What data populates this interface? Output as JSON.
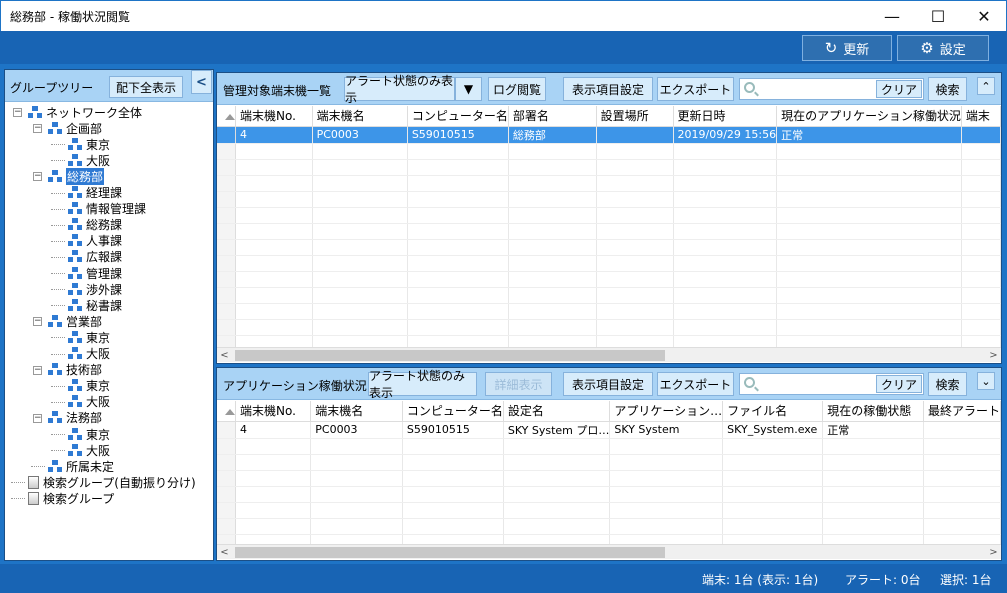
{
  "window": {
    "title": "総務部 - 稼働状況閲覧",
    "minimize": "—",
    "maximize": "☐",
    "close": "✕"
  },
  "toolbar": {
    "refresh_label": "更新",
    "settings_label": "設定"
  },
  "tree_panel": {
    "title": "グループツリー",
    "show_all_label": "配下全表示",
    "collapse": "<",
    "items": [
      "ネットワーク全体",
      "企画部",
      "東京",
      "大阪",
      "総務部",
      "経理課",
      "情報管理課",
      "総務課",
      "人事課",
      "広報課",
      "管理課",
      "渉外課",
      "秘書課",
      "営業部",
      "東京",
      "大阪",
      "技術部",
      "東京",
      "大阪",
      "法務部",
      "東京",
      "大阪",
      "所属未定",
      "検索グループ(自動振り分け)",
      "検索グループ"
    ]
  },
  "devices_panel": {
    "title": "管理対象端末機一覧",
    "alert_only_label": "アラート状態のみ表示",
    "log_view_label": "ログ閲覧",
    "display_settings_label": "表示項目設定",
    "export_label": "エクスポート",
    "clear_label": "クリア",
    "search_label": "検索",
    "search_placeholder": "",
    "collapse": "⌃",
    "columns": [
      "端末機No.",
      "端末機名",
      "コンピューター名",
      "部署名",
      "設置場所",
      "更新日時",
      "現在のアプリケーション稼働状況",
      "端末"
    ],
    "rows": [
      [
        "4",
        "PC0003",
        "S59010515",
        "総務部",
        "",
        "2019/09/29 15:56",
        "正常",
        ""
      ]
    ]
  },
  "apps_panel": {
    "title": "アプリケーション稼働状況",
    "alert_only_label": "アラート状態のみ表示",
    "detail_label": "詳細表示",
    "display_settings_label": "表示項目設定",
    "export_label": "エクスポート",
    "clear_label": "クリア",
    "search_label": "検索",
    "expand": "⌄",
    "columns": [
      "端末機No.",
      "端末機名",
      "コンピューター名",
      "設定名",
      "アプリケーション…",
      "ファイル名",
      "現在の稼働状態",
      "最終アラート"
    ],
    "rows": [
      [
        "4",
        "PC0003",
        "S59010515",
        "SKY System プロ…",
        "SKY System",
        "SKY_System.exe",
        "正常",
        ""
      ]
    ]
  },
  "status": {
    "devices": "端末: 1台 (表示: 1台)",
    "alerts": "アラート: 0台",
    "selected": "選択: 1台"
  },
  "colors": {
    "accent": "#1e74c6",
    "header_bg": "#a9d3f5",
    "selected_row": "#3d95e8"
  }
}
